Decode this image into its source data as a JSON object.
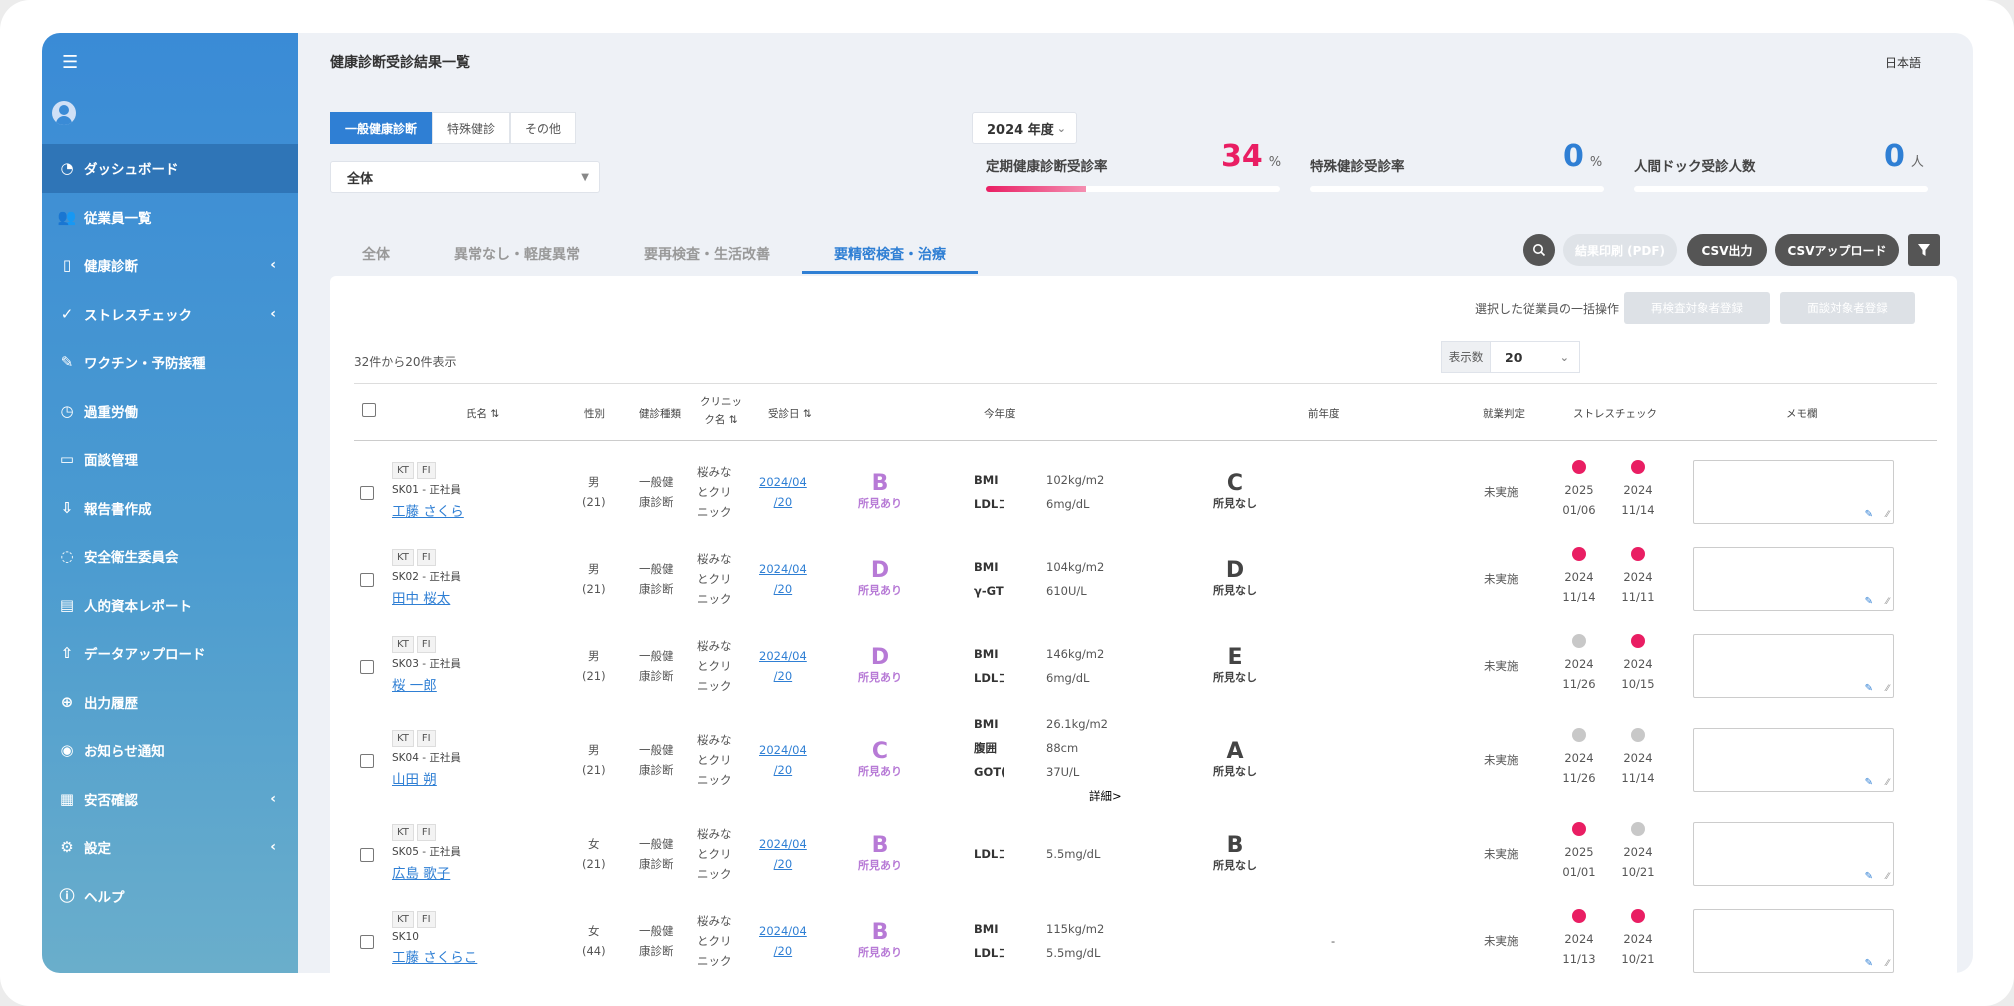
{
  "sidebar": {
    "menu_icon": "☰",
    "items": [
      {
        "icon": "dashboard-icon",
        "glyph": "◔",
        "label": "ダッシュボード",
        "active": true,
        "chev": ""
      },
      {
        "icon": "users-icon",
        "glyph": "👥",
        "label": "従業員一覧",
        "active": false,
        "chev": ""
      },
      {
        "icon": "health-check-icon",
        "glyph": "▯",
        "label": "健康診断",
        "active": false,
        "chev": "‹"
      },
      {
        "icon": "stress-check-icon",
        "glyph": "✓",
        "label": "ストレスチェック",
        "active": false,
        "chev": "‹"
      },
      {
        "icon": "vaccine-icon",
        "glyph": "✎",
        "label": "ワクチン・予防接種",
        "active": false,
        "chev": ""
      },
      {
        "icon": "clock-icon",
        "glyph": "◷",
        "label": "過重労働",
        "active": false,
        "chev": ""
      },
      {
        "icon": "monitor-icon",
        "glyph": "▭",
        "label": "面談管理",
        "active": false,
        "chev": ""
      },
      {
        "icon": "report-icon",
        "glyph": "⇩",
        "label": "報告書作成",
        "active": false,
        "chev": ""
      },
      {
        "icon": "committee-icon",
        "glyph": "◌",
        "label": "安全衛生委員会",
        "active": false,
        "chev": ""
      },
      {
        "icon": "hr-report-icon",
        "glyph": "▤",
        "label": "人的資本レポート",
        "active": false,
        "chev": ""
      },
      {
        "icon": "upload-icon",
        "glyph": "⇧",
        "label": "データアップロード",
        "active": false,
        "chev": ""
      },
      {
        "icon": "download-history-icon",
        "glyph": "⊕",
        "label": "出力履歴",
        "active": false,
        "chev": ""
      },
      {
        "icon": "notification-icon",
        "glyph": "◉",
        "label": "お知らせ通知",
        "active": false,
        "chev": ""
      },
      {
        "icon": "safety-confirm-icon",
        "glyph": "▦",
        "label": "安否確認",
        "active": false,
        "chev": "‹"
      },
      {
        "icon": "gear-icon",
        "glyph": "⚙",
        "label": "設定",
        "active": false,
        "chev": "‹"
      },
      {
        "icon": "help-icon",
        "glyph": "ⓘ",
        "label": "ヘルプ",
        "active": false,
        "chev": ""
      }
    ]
  },
  "header": {
    "title": "健康診断受診結果一覧",
    "language": "日本語"
  },
  "filters": {
    "seg_general": "一般健康診断",
    "seg_special": "特殊健診",
    "seg_other": "その他",
    "scope": "全体",
    "fiscal_year": "2024 年度"
  },
  "stats": {
    "regular": {
      "label": "定期健康診断受診率",
      "value": "34",
      "unit": "%",
      "percent": 34
    },
    "special": {
      "label": "特殊健診受診率",
      "value": "0",
      "unit": "%",
      "percent": 0
    },
    "dock": {
      "label": "人間ドック受診人数",
      "value": "0",
      "unit": "人"
    }
  },
  "tabs": {
    "all": "全体",
    "normal": "異常なし・軽度異常",
    "recheck": "要再検査・生活改善",
    "detailed": "要精密検査・治療"
  },
  "toolbar": {
    "print_pdf": "結果印刷 (PDF)",
    "csv_export": "CSV出力",
    "csv_upload": "CSVアップロード"
  },
  "bulk": {
    "label": "選択した従業員の一括操作",
    "recheck_register": "再検査対象者登録",
    "interview_register": "面談対象者登録"
  },
  "list": {
    "count_text": "32件から20件表示",
    "page_size_label": "表示数",
    "page_size": "20",
    "headers": {
      "name": "氏名",
      "sex": "性別",
      "exam_type": "健診種類",
      "clinic_1": "クリニッ",
      "clinic_2": "ク名",
      "date": "受診日",
      "this_year": "今年度",
      "last_year": "前年度",
      "work_judgement": "就業判定",
      "stress_check": "ストレスチェック",
      "memo": "メモ欄"
    },
    "rows": [
      {
        "tags": [
          "KT",
          "FI"
        ],
        "code": "SK01 - 正社員",
        "name": "工藤 さくら",
        "sex": "男",
        "age": "(21)",
        "exam_1": "一般健",
        "exam_2": "康診断",
        "clinic_1": "桜みな",
        "clinic_2": "とクリ",
        "clinic_3": "ニック",
        "date_1": "2024/04",
        "date_2": "/20",
        "grade": "B",
        "grade_note": "所見あり",
        "grade_color": "#b77ad6",
        "measures": [
          {
            "k": "BMI",
            "v": "102kg/m2"
          },
          {
            "k": "LDLコ",
            "v": "6mg/dL"
          }
        ],
        "prev_grade": "C",
        "prev_note": "所見なし",
        "work": "未実施",
        "s1_color": "#e91e63",
        "s1_y": "2025",
        "s1_d": "01/06",
        "s2_color": "#e91e63",
        "s2_y": "2024",
        "s2_d": "11/14"
      },
      {
        "tags": [
          "KT",
          "FI"
        ],
        "code": "SK02 - 正社員",
        "name": "田中 桜太",
        "sex": "男",
        "age": "(21)",
        "exam_1": "一般健",
        "exam_2": "康診断",
        "clinic_1": "桜みな",
        "clinic_2": "とクリ",
        "clinic_3": "ニック",
        "date_1": "2024/04",
        "date_2": "/20",
        "grade": "D",
        "grade_note": "所見あり",
        "grade_color": "#b77ad6",
        "measures": [
          {
            "k": "BMI",
            "v": "104kg/m2"
          },
          {
            "k": "γ-GT",
            "v": "610U/L"
          }
        ],
        "prev_grade": "D",
        "prev_note": "所見なし",
        "work": "未実施",
        "s1_color": "#e91e63",
        "s1_y": "2024",
        "s1_d": "11/14",
        "s2_color": "#e91e63",
        "s2_y": "2024",
        "s2_d": "11/11"
      },
      {
        "tags": [
          "KT",
          "FI"
        ],
        "code": "SK03 - 正社員",
        "name": "桜 一郎",
        "sex": "男",
        "age": "(21)",
        "exam_1": "一般健",
        "exam_2": "康診断",
        "clinic_1": "桜みな",
        "clinic_2": "とクリ",
        "clinic_3": "ニック",
        "date_1": "2024/04",
        "date_2": "/20",
        "grade": "D",
        "grade_note": "所見あり",
        "grade_color": "#b77ad6",
        "measures": [
          {
            "k": "BMI",
            "v": "146kg/m2"
          },
          {
            "k": "LDLコ",
            "v": "6mg/dL"
          }
        ],
        "prev_grade": "E",
        "prev_note": "所見なし",
        "work": "未実施",
        "s1_color": "#c8c8c8",
        "s1_y": "2024",
        "s1_d": "11/26",
        "s2_color": "#e91e63",
        "s2_y": "2024",
        "s2_d": "10/15"
      },
      {
        "tags": [
          "KT",
          "FI"
        ],
        "code": "SK04 - 正社員",
        "name": "山田 朔",
        "sex": "男",
        "age": "(21)",
        "exam_1": "一般健",
        "exam_2": "康診断",
        "clinic_1": "桜みな",
        "clinic_2": "とクリ",
        "clinic_3": "ニック",
        "date_1": "2024/04",
        "date_2": "/20",
        "grade": "C",
        "grade_note": "所見あり",
        "grade_color": "#b77ad6",
        "measures": [
          {
            "k": "BMI",
            "v": "26.1kg/m2"
          },
          {
            "k": "腹囲",
            "v": "88cm"
          },
          {
            "k": "GOT(",
            "v": "37U/L"
          }
        ],
        "detail_link": "詳細>",
        "prev_grade": "A",
        "prev_note": "所見なし",
        "work": "未実施",
        "s1_color": "#c8c8c8",
        "s1_y": "2024",
        "s1_d": "11/26",
        "s2_color": "#c8c8c8",
        "s2_y": "2024",
        "s2_d": "11/14"
      },
      {
        "tags": [
          "KT",
          "FI"
        ],
        "code": "SK05 - 正社員",
        "name": "広島 歌子",
        "sex": "女",
        "age": "(21)",
        "exam_1": "一般健",
        "exam_2": "康診断",
        "clinic_1": "桜みな",
        "clinic_2": "とクリ",
        "clinic_3": "ニック",
        "date_1": "2024/04",
        "date_2": "/20",
        "grade": "B",
        "grade_note": "所見あり",
        "grade_color": "#b77ad6",
        "measures": [
          {
            "k": "LDLコ",
            "v": "5.5mg/dL"
          }
        ],
        "prev_grade": "B",
        "prev_note": "所見なし",
        "work": "未実施",
        "s1_color": "#e91e63",
        "s1_y": "2025",
        "s1_d": "01/01",
        "s2_color": "#c8c8c8",
        "s2_y": "2024",
        "s2_d": "10/21"
      },
      {
        "tags": [
          "KT",
          "FI"
        ],
        "code": "SK10",
        "name": "工藤 さくらこ",
        "sex": "女",
        "age": "(44)",
        "exam_1": "一般健",
        "exam_2": "康診断",
        "clinic_1": "桜みな",
        "clinic_2": "とクリ",
        "clinic_3": "ニック",
        "date_1": "2024/04",
        "date_2": "/20",
        "grade": "B",
        "grade_note": "所見あり",
        "grade_color": "#b77ad6",
        "measures": [
          {
            "k": "BMI",
            "v": "115kg/m2"
          },
          {
            "k": "LDLコ",
            "v": "5.5mg/dL"
          }
        ],
        "prev_grade": "",
        "prev_note": "",
        "prev_dash": "-",
        "work": "未実施",
        "s1_color": "#e91e63",
        "s1_y": "2024",
        "s1_d": "11/13",
        "s2_color": "#e91e63",
        "s2_y": "2024",
        "s2_d": "10/21"
      }
    ]
  },
  "colors": {
    "accent": "#2f7fd4",
    "pink": "#e91e63",
    "purple": "#b77ad6",
    "sidebar_active": "#2f75b7"
  }
}
